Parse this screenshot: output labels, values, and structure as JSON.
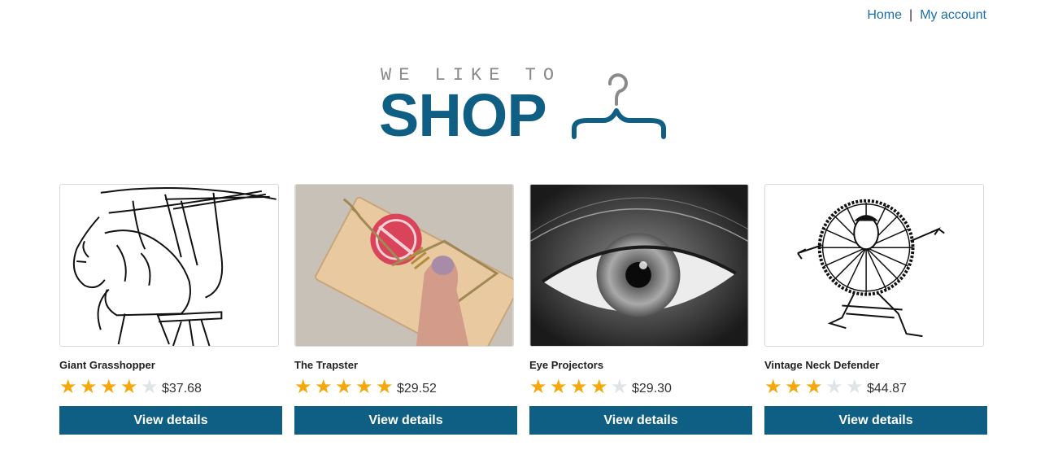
{
  "nav": {
    "home": "Home",
    "separator": "|",
    "account": "My account"
  },
  "logo": {
    "tagline": "WE LIKE TO",
    "wordmark": "SHOP"
  },
  "colors": {
    "brand": "#0f5f85",
    "link": "#1a6fa8",
    "star_on": "#f5a80b",
    "star_off": "#dfe4e7"
  },
  "products": [
    {
      "name": "Giant Grasshopper",
      "rating": 4,
      "price": "$37.68",
      "button": "View details",
      "image": "grasshopper-man-illustration"
    },
    {
      "name": "The Trapster",
      "rating": 5,
      "price": "$29.52",
      "button": "View details",
      "image": "mousetrap-on-finger-photo"
    },
    {
      "name": "Eye Projectors",
      "rating": 4,
      "price": "$29.30",
      "button": "View details",
      "image": "eye-closeup-photo"
    },
    {
      "name": "Vintage Neck Defender",
      "rating": 3,
      "price": "$44.87",
      "button": "View details",
      "image": "ruff-collar-man-illustration"
    }
  ]
}
